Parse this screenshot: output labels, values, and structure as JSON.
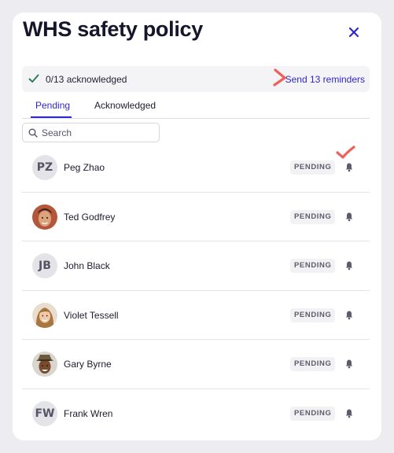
{
  "modal": {
    "title": "WHS safety policy"
  },
  "banner": {
    "acknowledged_text": "0/13 acknowledged",
    "reminder_link": "Send 13 reminders"
  },
  "tabs": [
    {
      "label": "Pending",
      "active": true
    },
    {
      "label": "Acknowledged",
      "active": false
    }
  ],
  "search": {
    "placeholder": "Search",
    "value": ""
  },
  "people": [
    {
      "name": "Peg Zhao",
      "initials": "PZ",
      "status": "PENDING"
    },
    {
      "name": "Ted Godfrey",
      "initials": "",
      "status": "PENDING"
    },
    {
      "name": "John Black",
      "initials": "JB",
      "status": "PENDING"
    },
    {
      "name": "Violet Tessell",
      "initials": "",
      "status": "PENDING"
    },
    {
      "name": "Gary Byrne",
      "initials": "",
      "status": "PENDING"
    },
    {
      "name": "Frank Wren",
      "initials": "FW",
      "status": "PENDING"
    }
  ],
  "colors": {
    "accent": "#2f27c9",
    "annotation": "#f0605a",
    "check": "#2e7d5b"
  }
}
